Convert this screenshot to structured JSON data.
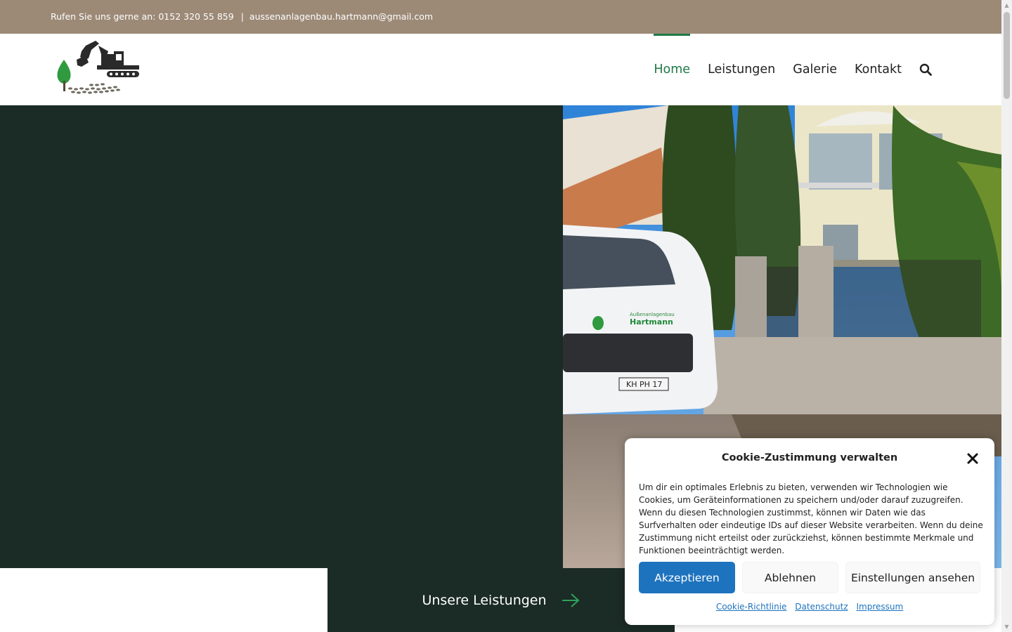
{
  "topbar": {
    "phone_text": "Rufen Sie uns gerne an: 0152 320 55 859",
    "separator": "|",
    "email": "aussenanlagenbau.hartmann@gmail.com"
  },
  "nav": {
    "items": [
      {
        "label": "Home",
        "active": true
      },
      {
        "label": "Leistungen"
      },
      {
        "label": "Galerie"
      },
      {
        "label": "Kontakt"
      }
    ],
    "search_icon": "search-icon"
  },
  "hero": {
    "van_brand_line1": "Außenanlagenbau",
    "van_brand_line2": "Hartmann",
    "license_plate": "KH PH 17"
  },
  "cta": {
    "label": "Unsere Leistungen",
    "icon": "arrow-right-icon"
  },
  "cookie": {
    "title": "Cookie-Zustimmung verwalten",
    "close_icon": "close-icon",
    "text": "Um dir ein optimales Erlebnis zu bieten, verwenden wir Technologien wie Cookies, um Geräteinformationen zu speichern und/oder darauf zuzugreifen. Wenn du diesen Technologien zustimmst, können wir Daten wie das Surfverhalten oder eindeutige IDs auf dieser Website verarbeiten. Wenn du deine Zustimmung nicht erteilst oder zurückziehst, können bestimmte Merkmale und Funktionen beeinträchtigt werden.",
    "accept_label": "Akzeptieren",
    "decline_label": "Ablehnen",
    "settings_label": "Einstellungen ansehen",
    "links": [
      "Cookie-Richtlinie",
      "Datenschutz",
      "Impressum"
    ]
  },
  "colors": {
    "topbar": "#9c8a77",
    "accent_green": "#1e7a45",
    "hero_dark": "#1b2b25",
    "button_blue": "#1e73be"
  }
}
